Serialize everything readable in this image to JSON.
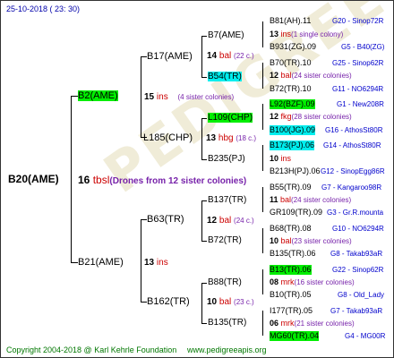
{
  "date": "25-10-2018 ( 23: 30)",
  "copyright": "Copyright 2004-2018 @ Karl Kehrle Foundation",
  "website": "www.pedigreeapis.org",
  "root": {
    "name": "B20(AME)",
    "num": "16",
    "type": "tbsl",
    "note": "(Drones from 12 sister colonies)"
  },
  "gen1": [
    {
      "name": "B2(AME)",
      "num": "15",
      "type": "ins",
      "note": "(4 sister colonies)"
    },
    {
      "name": "B21(AME)",
      "num": "13",
      "type": "ins",
      "note": ""
    }
  ],
  "gen2": [
    {
      "name": "B17(AME)",
      "num": "",
      "type": "",
      "note": ""
    },
    {
      "name": "L185(CHP)",
      "num": "13",
      "type": "hbg",
      "note": "(18 c.)"
    },
    {
      "name": "B63(TR)",
      "num": "",
      "type": "",
      "note": ""
    },
    {
      "name": "B162(TR)",
      "num": "10",
      "type": "bal",
      "note": "(23 c.)"
    }
  ],
  "gen3": [
    {
      "name": "B7(AME)",
      "num": "14",
      "type": "bal",
      "note": "(22 c.)"
    },
    {
      "name": "B54(TR)",
      "num": "",
      "type": "",
      "note": ""
    },
    {
      "name": "L109(CHP)",
      "num": "13",
      "type": "hbg",
      "note": "(18 c.)"
    },
    {
      "name": "B235(PJ)",
      "num": "",
      "type": "",
      "note": ""
    },
    {
      "name": "B137(TR)",
      "num": "12",
      "type": "bal",
      "note": "(24 c.)"
    },
    {
      "name": "B72(TR)",
      "num": "",
      "type": "",
      "note": ""
    },
    {
      "name": "B88(TR)",
      "num": "10",
      "type": "bal",
      "note": "(23 c.)"
    },
    {
      "name": "B135(TR)",
      "num": "",
      "type": "",
      "note": ""
    }
  ],
  "gen4": [
    {
      "top": "B81(AH).11",
      "topRight": "G20 - Sinop72R",
      "mid_num": "13",
      "mid_type": "ins",
      "mid_note": "(1 single colony)",
      "bot": "B931(ZG).09",
      "botRight": "G5 - B40(ZG)"
    },
    {
      "top": "B70(TR).10",
      "topRight": "G25 - Sinop62R",
      "mid_num": "12",
      "mid_type": "bal",
      "mid_note": "(24 sister colonies)",
      "bot": "B72(TR).10",
      "botRight": "G11 - NO6294R"
    },
    {
      "top": "L92(BZF).09",
      "topRight": "G1 - New208R",
      "mid_num": "12",
      "mid_type": "fkg",
      "mid_note": "(28 sister colonies)",
      "bot": "B100(JG).09",
      "botRight": "G16 - AthosSt80R"
    },
    {
      "top": "B173(PJ).06",
      "topRight": "G14 - AthosSt80R",
      "mid_num": "10",
      "mid_type": "ins",
      "mid_note": "",
      "bot": "B213H(PJ).06",
      "botRight": "G12 - SinopEgg86R"
    },
    {
      "top": "B55(TR).09",
      "topRight": "G7 - Kangaroo98R",
      "mid_num": "11",
      "mid_type": "bal",
      "mid_note": "(24 sister colonies)",
      "bot": "GR109(TR).09",
      "botRight": "G3 - Gr.R.mounta"
    },
    {
      "top": "B68(TR).08",
      "topRight": "G10 - NO6294R",
      "mid_num": "10",
      "mid_type": "bal",
      "mid_note": "(23 sister colonies)",
      "bot": "B135(TR).06",
      "botRight": "G8 - Takab93aR"
    },
    {
      "top": "B13(TR).06",
      "topRight": "G22 - Sinop62R",
      "mid_num": "08",
      "mid_type": "mrk",
      "mid_note": "(16 sister colonies)",
      "bot": "B10(TR).05",
      "botRight": "G8 - Old_Lady"
    },
    {
      "top": "I177(TR).05",
      "topRight": "G7 - Takab93aR",
      "mid_num": "06",
      "mid_type": "mrk",
      "mid_note": "(21 sister colonies)",
      "bot": "MG60(TR).04",
      "botRight": "G4 - MG00R"
    }
  ],
  "colors": {
    "green_highlight": "#00ee00",
    "cyan_highlight": "#00eeee",
    "red": "#cc0000",
    "blue": "#0000cc",
    "purple": "#7722aa"
  }
}
